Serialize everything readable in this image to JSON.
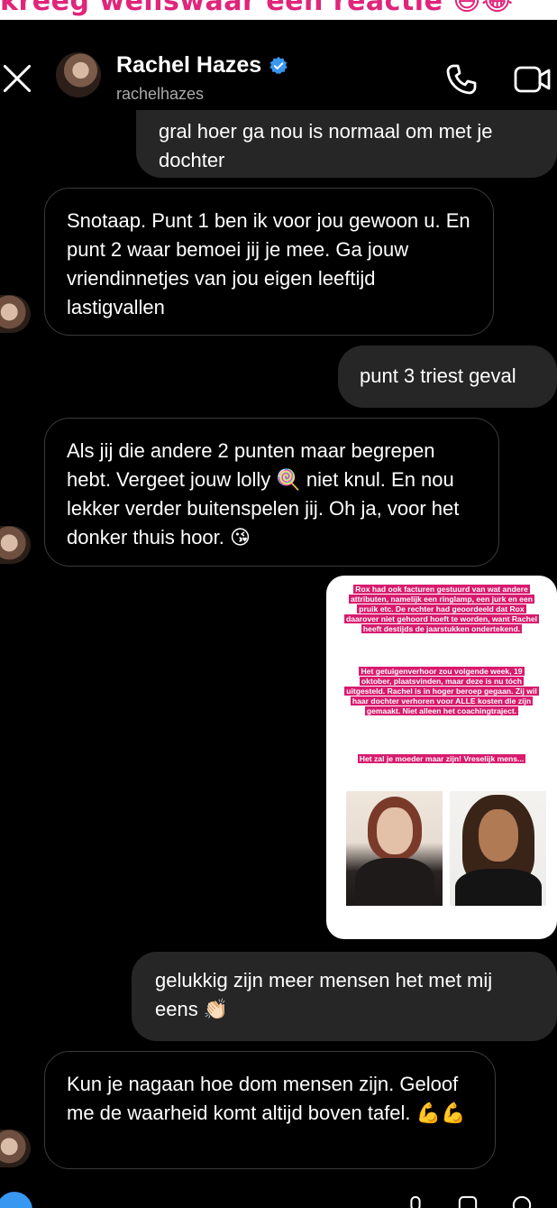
{
  "banner": {
    "text": "kreeg wellswaar een reactie 😅😂"
  },
  "header": {
    "name": "Rachel Hazes",
    "username": "rachelhazes",
    "icons": {
      "close": "close-icon",
      "verified": "verified-badge-icon",
      "call": "phone-icon",
      "video": "video-camera-icon"
    }
  },
  "messages": [
    {
      "direction": "out",
      "text": "gral hoer ga nou is normaal om met je dochter"
    },
    {
      "direction": "in",
      "text": "Snotaap. Punt 1 ben ik voor jou gewoon u. En punt 2 waar bemoei jij je mee. Ga jouw vriendinnetjes van jou eigen leeftijd lastigvallen"
    },
    {
      "direction": "out",
      "text": "punt 3 triest geval"
    },
    {
      "direction": "in",
      "text": "Als jij die andere 2 punten maar begrepen hebt. Vergeet jouw lolly 🍭 niet knul. En nou lekker verder buitenspelen jij. Oh ja, voor het donker thuis hoor. 😘"
    },
    {
      "direction": "out",
      "text": "gelukkig zijn meer mensen het met mij eens 👏🏻"
    },
    {
      "direction": "in",
      "text": "Kun je nagaan hoe dom mensen zijn. Geloof me de waarheid komt altijd boven tafel. 💪💪"
    }
  ],
  "story": {
    "para1": "Rox had ook facturen gestuurd van wat andere attributen, namelijk een ringlamp, een jurk en een pruik etc. De rechter had geoordeeld dat Rox daarover niet gehoord hoeft te worden, want Rachel heeft destijds de jaarstukken ondertekend.",
    "para2": "Het getuigenverhoor zou volgende week, 19 oktober, plaatsvinden, maar deze is nu tóch uitgesteld. Rachel is in hoger beroep gegaan. Zij wil haar dochter verhoren voor ALLE kosten die zijn gemaakt. Niet alleen het coachingtraject.",
    "para3": "Het zal je moeder maar zijn! Vreselijk mens..."
  },
  "colors": {
    "background": "#000000",
    "outgoing_bubble": "#262626",
    "story_highlight": "#d81b6e",
    "verified": "#3897f0",
    "banner_text": "#e0257a"
  }
}
